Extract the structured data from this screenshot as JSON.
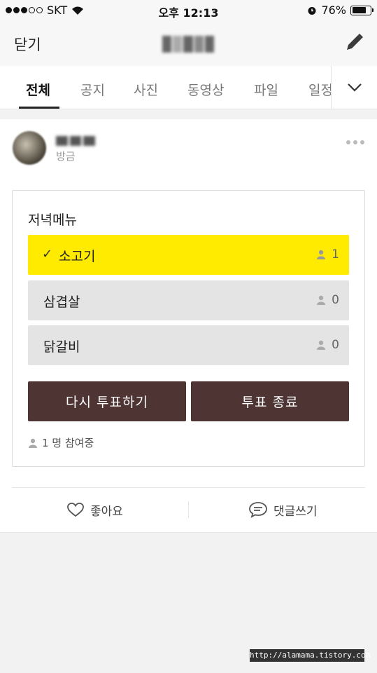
{
  "status_bar": {
    "carrier": "SKT",
    "time": "오후 12:13",
    "battery_percent": "76%",
    "battery_level": 0.76
  },
  "nav": {
    "close_label": "닫기"
  },
  "tabs": [
    {
      "label": "전체",
      "active": true
    },
    {
      "label": "공지"
    },
    {
      "label": "사진"
    },
    {
      "label": "동영상"
    },
    {
      "label": "파일"
    },
    {
      "label": "일정"
    }
  ],
  "post": {
    "time": "방금",
    "poll": {
      "title": "저녁메뉴",
      "options": [
        {
          "label": "소고기",
          "count": "1",
          "selected": true
        },
        {
          "label": "삼겹살",
          "count": "0",
          "selected": false
        },
        {
          "label": "닭갈비",
          "count": "0",
          "selected": false
        }
      ],
      "revote_label": "다시 투표하기",
      "end_label": "투표 종료",
      "participants": "1 명 참여중"
    },
    "like_label": "좋아요",
    "comment_label": "댓글쓰기"
  },
  "colors": {
    "selected_option": "#ffeb00",
    "button": "#4e3533",
    "option": "#e4e4e4"
  },
  "watermark": "http://alamama.tistory.com"
}
